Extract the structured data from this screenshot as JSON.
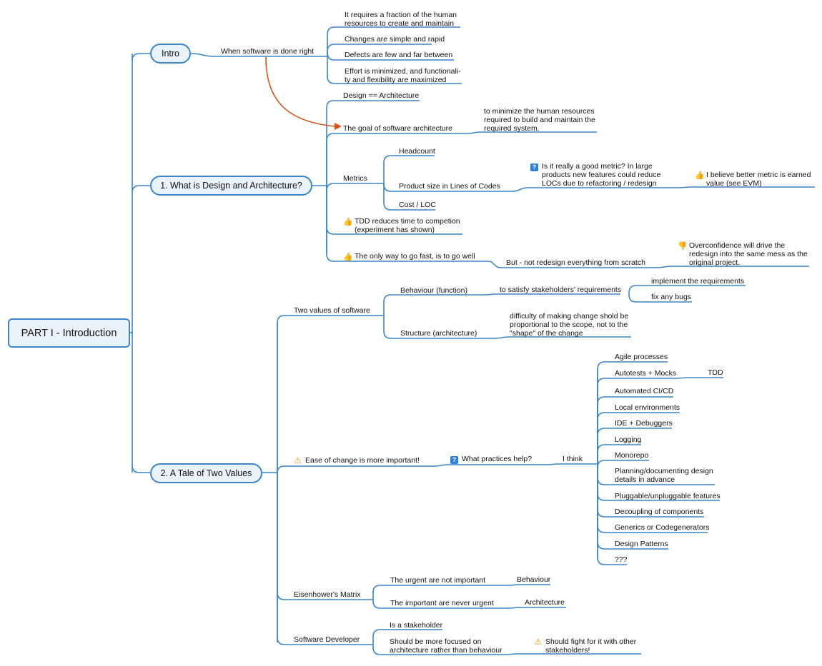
{
  "colors": {
    "connector": "#3d86c6",
    "relationship_arrow": "#d4541c",
    "topic_fill": "#eaf2fb",
    "thumbs_up": "#3cc43c",
    "thumbs_down": "#e0393b",
    "question": "#2f7fd6",
    "warning": "#f0a020"
  },
  "root": {
    "label": "PART I - Introduction"
  },
  "intro": {
    "label": "Intro",
    "child": "When software is done right",
    "items": [
      "It requires a fraction of the human\nresources to create and maintain",
      "Changes are simple and rapid",
      "Defects are few and far between",
      "Effort is minimized, and functionali-\nty and flexibility are maximized"
    ]
  },
  "section1": {
    "label": "1. What is Design and Architecture?",
    "design_eq": "Design == Architecture",
    "goal": "The goal of software architecture",
    "goal_detail": "to minimize the human resources\nrequired to build and maintain the\nrequired system.",
    "metrics": "Metrics",
    "metrics_items": [
      "Headcount",
      "Product size in Lines of Codes",
      "Cost / LOC"
    ],
    "loc_question": "Is it really a good metric? In large\nproducts new features could reduce\nLOCs due to refactoring / redesign",
    "loc_answer": "I believe better metric is earned\nvalue (see EVM)",
    "tdd": "TDD reduces time to competion\n(experiment has shown)",
    "go_fast": "The only way to go fast, is to go well",
    "not_redesign": "But - not redesign everything from scratch",
    "overconfidence": "Overconfidence will drive the\nredesign into the same mess as the\noriginal project."
  },
  "section2": {
    "label": "2. A Tale of Two Values",
    "two_values": "Two values of software",
    "behaviour": "Behaviour (function)",
    "behaviour_goal": "to satisfy stakeholders' requirements",
    "behaviour_items": [
      "implement the requirements",
      "fix any bugs"
    ],
    "structure": "Structure (architecture)",
    "structure_detail": "difficulty of making change shold be\nproportional to the scope, not to the\n\"shape\" of the change",
    "ease": "Ease of change is more important!",
    "practices_q": "What practices help?",
    "i_think": "I think",
    "practices": [
      "Agile processes",
      "Autotests + Mocks",
      "Automated CI/CD",
      "Local environments",
      "IDE + Debuggers",
      "Logging",
      "Monorepo",
      "Planning/documenting design\ndetails in advance",
      "Pluggable/unpluggable features",
      "Decoupling of components",
      "Generics or Codegenerators",
      "Design Patterns",
      "???"
    ],
    "tdd": "TDD",
    "eisenhower": "Eisenhower's Matrix",
    "urgent": "The urgent are not important",
    "urgent_ans": "Behaviour",
    "important": "The important are never urgent",
    "important_ans": "Architecture",
    "developer": "Software Developer",
    "stakeholder": "Is a stakeholder",
    "focused": "Should be more focused on\narchitecture rather than behaviour",
    "fight": "Should fight for it with other\nstakeholders!"
  }
}
